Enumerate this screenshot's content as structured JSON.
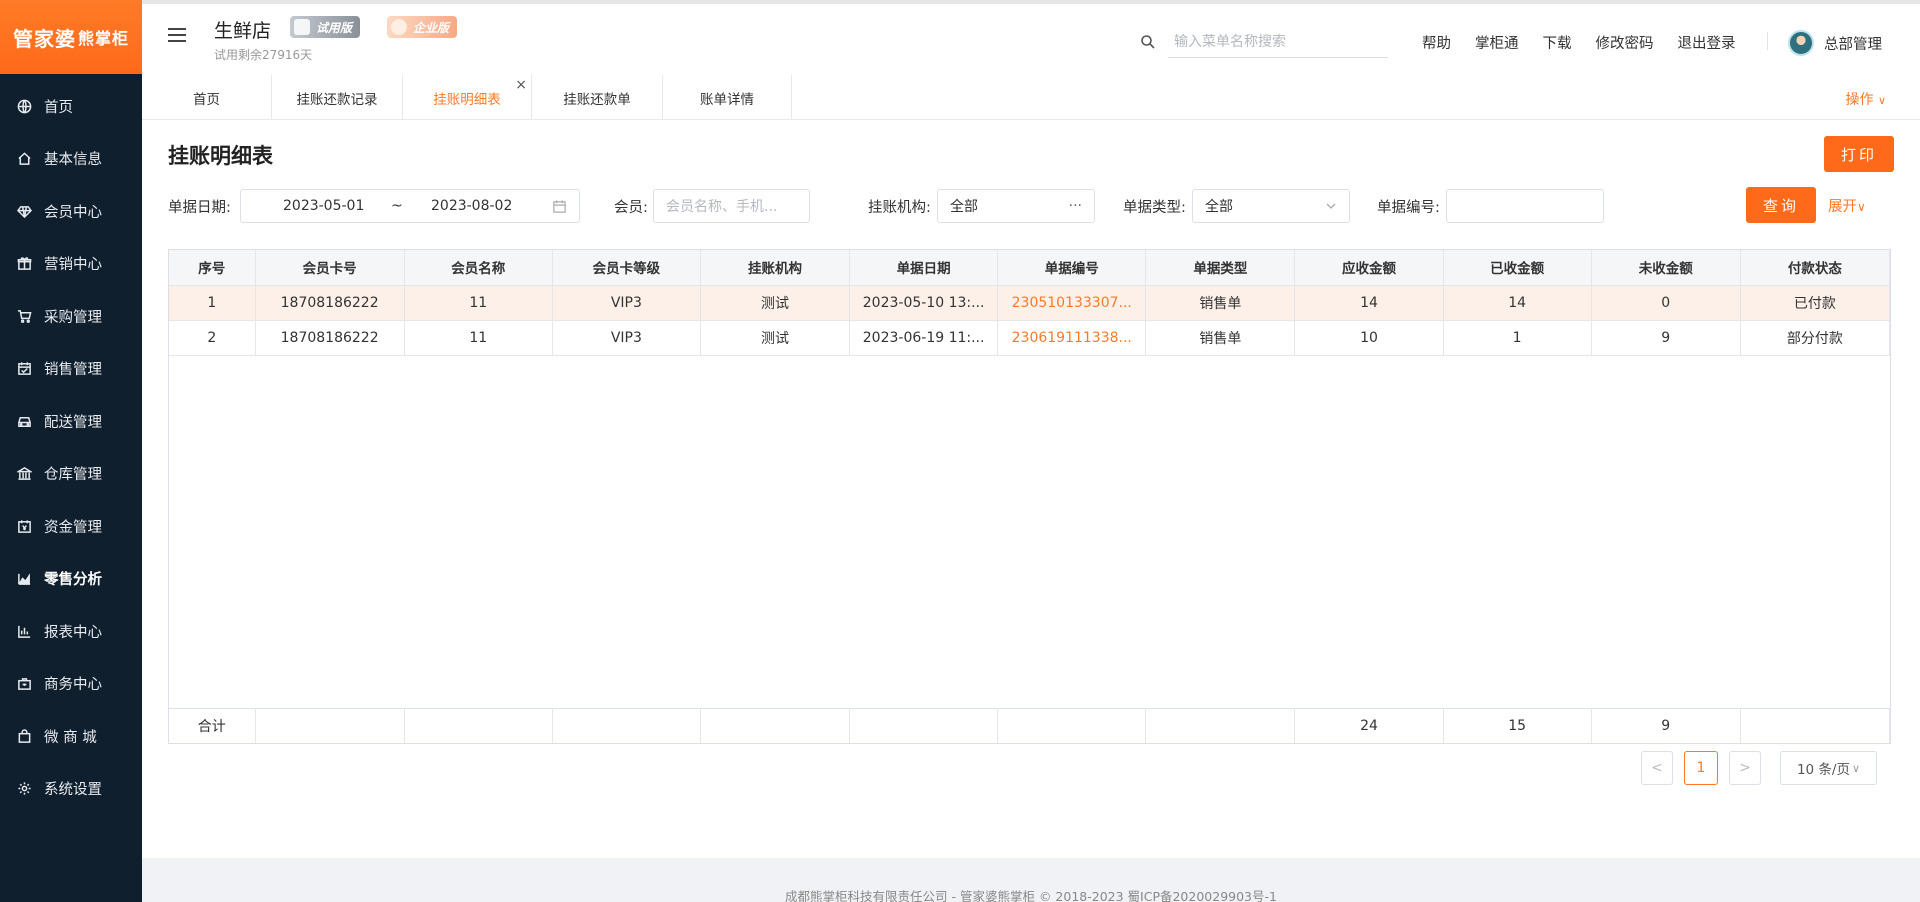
{
  "app": {
    "logo_main": "管家婆",
    "logo_sub": "熊掌柜",
    "store_name": "生鲜店",
    "trial_days": "试用剩余27916天",
    "badge_trial": "试用版",
    "badge_enterprise": "企业版"
  },
  "sidebar": {
    "items": [
      {
        "label": "首页",
        "icon": "globe-icon"
      },
      {
        "label": "基本信息",
        "icon": "home-icon"
      },
      {
        "label": "会员中心",
        "icon": "diamond-icon"
      },
      {
        "label": "营销中心",
        "icon": "gift-icon"
      },
      {
        "label": "采购管理",
        "icon": "cart-icon"
      },
      {
        "label": "销售管理",
        "icon": "calendar-icon"
      },
      {
        "label": "配送管理",
        "icon": "car-icon"
      },
      {
        "label": "仓库管理",
        "icon": "bank-icon"
      },
      {
        "label": "资金管理",
        "icon": "money-calendar-icon"
      },
      {
        "label": "零售分析",
        "icon": "area-chart-icon",
        "active": true
      },
      {
        "label": "报表中心",
        "icon": "bar-chart-icon"
      },
      {
        "label": "商务中心",
        "icon": "briefcase-icon"
      },
      {
        "label": "微 商 城",
        "icon": "bag-icon"
      },
      {
        "label": "系统设置",
        "icon": "gear-icon"
      }
    ]
  },
  "header": {
    "search_placeholder": "输入菜单名称搜索",
    "links": [
      "帮助",
      "掌柜通",
      "下载",
      "修改密码",
      "退出登录"
    ],
    "user_name": "总部管理"
  },
  "tabs": {
    "items": [
      "首页",
      "挂账还款记录",
      "挂账明细表",
      "挂账还款单",
      "账单详情"
    ],
    "active_index": 2,
    "close_glyph": "×",
    "ops_label": "操作"
  },
  "page": {
    "title": "挂账明细表",
    "print_label": "打印",
    "filters": {
      "date_label": "单据日期",
      "date_start": "2023-05-01",
      "date_sep": "~",
      "date_end": "2023-08-02",
      "member_label": "会员",
      "member_placeholder": "会员名称、手机...",
      "org_label": "挂账机构",
      "org_value": "全部",
      "org_more": "···",
      "type_label": "单据类型",
      "type_value": "全部",
      "number_label": "单据编号",
      "number_value": "",
      "colon": ":"
    },
    "query_label": "查询",
    "expand_label": "展开"
  },
  "table": {
    "columns": [
      "序号",
      "会员卡号",
      "会员名称",
      "会员卡等级",
      "挂账机构",
      "单据日期",
      "单据编号",
      "单据类型",
      "应收金额",
      "已收金额",
      "未收金额",
      "付款状态"
    ],
    "rows": [
      [
        "1",
        "18708186222",
        "11",
        "VIP3",
        "测试",
        "2023-05-10 13:...",
        "230510133307...",
        "销售单",
        "14",
        "14",
        "0",
        "已付款"
      ],
      [
        "2",
        "18708186222",
        "11",
        "VIP3",
        "测试",
        "2023-06-19 11:...",
        "230619111338...",
        "销售单",
        "10",
        "1",
        "9",
        "部分付款"
      ]
    ],
    "summary": [
      "合计",
      "",
      "",
      "",
      "",
      "",
      "",
      "",
      "24",
      "15",
      "9",
      ""
    ]
  },
  "pagination": {
    "prev": "<",
    "current": "1",
    "next": ">",
    "page_size": "10 条/页"
  },
  "footer": {
    "text": "成都熊掌柜科技有限责任公司 - 管家婆熊掌柜 © 2018-2023 蜀ICP备2020029903号-1"
  },
  "colors": {
    "accent": "#ff6a1a",
    "sidebar_bg": "#0f1f2e",
    "row_highlight": "#fdf0e9"
  }
}
